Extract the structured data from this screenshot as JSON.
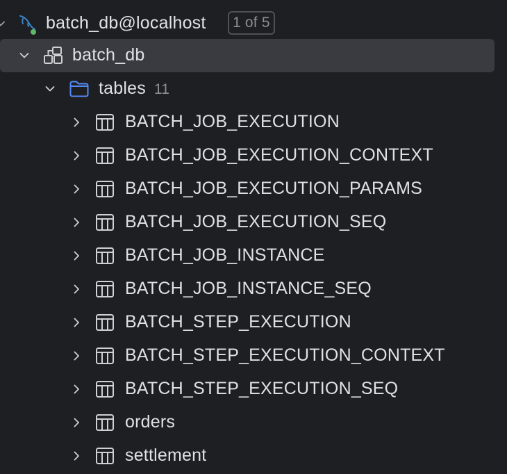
{
  "datasource": {
    "name": "batch_db@localhost",
    "badge": "1 of 5",
    "icon": "mysql-dolphin-icon"
  },
  "schema": {
    "name": "batch_db",
    "icon": "schema-icon"
  },
  "folder": {
    "name": "tables",
    "count": "11",
    "icon": "folder-icon"
  },
  "tables": [
    {
      "name": "BATCH_JOB_EXECUTION"
    },
    {
      "name": "BATCH_JOB_EXECUTION_CONTEXT"
    },
    {
      "name": "BATCH_JOB_EXECUTION_PARAMS"
    },
    {
      "name": "BATCH_JOB_EXECUTION_SEQ"
    },
    {
      "name": "BATCH_JOB_INSTANCE"
    },
    {
      "name": "BATCH_JOB_INSTANCE_SEQ"
    },
    {
      "name": "BATCH_STEP_EXECUTION"
    },
    {
      "name": "BATCH_STEP_EXECUTION_CONTEXT"
    },
    {
      "name": "BATCH_STEP_EXECUTION_SEQ"
    },
    {
      "name": "orders"
    },
    {
      "name": "settlement"
    }
  ],
  "colors": {
    "background": "#1e1f22",
    "selection": "#393b40",
    "text": "#dfe1e5",
    "muted": "#8c8f94",
    "folder_accent": "#548af7",
    "status_connected": "#5fb865"
  }
}
